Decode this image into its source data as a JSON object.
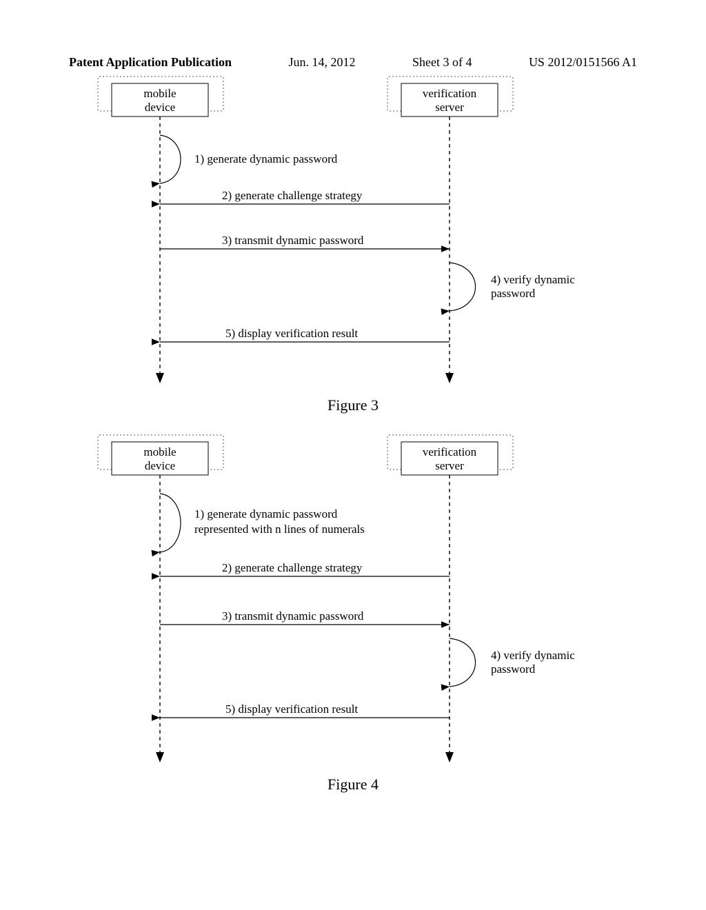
{
  "header": {
    "leftLabel": "Patent Application Publication",
    "dateLabel": "Jun. 14, 2012",
    "sheetLabel": "Sheet 3 of 4",
    "pubNumber": "US 2012/0151566 A1"
  },
  "fig3": {
    "caption": "Figure 3",
    "actorLeftLine1": "mobile",
    "actorLeftLine2": "device",
    "actorRightLine1": "verification",
    "actorRightLine2": "server",
    "step1": "1) generate dynamic password",
    "step2": "2) generate challenge strategy",
    "step3": "3) transmit dynamic password",
    "step4a": "4) verify dynamic",
    "step4b": "password",
    "step5": "5) display verification result"
  },
  "fig4": {
    "caption": "Figure 4",
    "actorLeftLine1": "mobile",
    "actorLeftLine2": "device",
    "actorRightLine1": "verification",
    "actorRightLine2": "server",
    "step1a": "1) generate dynamic password",
    "step1b": "represented with n lines of numerals",
    "step2": "2) generate challenge strategy",
    "step3": "3) transmit dynamic password",
    "step4a": "4) verify dynamic",
    "step4b": "password",
    "step5": "5) display verification result"
  }
}
